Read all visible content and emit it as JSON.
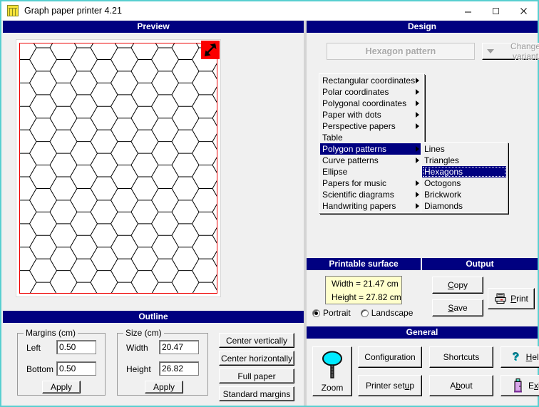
{
  "window": {
    "title": "Graph paper printer 4.21",
    "icon": "graph-paper-icon",
    "minimize": "–",
    "maximize": "□",
    "close": "✕"
  },
  "preview": {
    "caption": "Preview",
    "resize_handle_icon": "resize-diagonal-arrow-icon",
    "paper_border_color": "#ee0000",
    "pattern": "hexagons"
  },
  "design": {
    "caption": "Design",
    "pattern_name": "Hexagon pattern",
    "change_variant": "Change variant",
    "change_variant_icon": "chevron-down-icon",
    "menu": [
      {
        "label": "Rectangular coordinates",
        "submenu": true,
        "selected": false
      },
      {
        "label": "Polar coordinates",
        "submenu": true,
        "selected": false
      },
      {
        "label": "Polygonal coordinates",
        "submenu": true,
        "selected": false
      },
      {
        "label": "Paper with dots",
        "submenu": true,
        "selected": false
      },
      {
        "label": "Perspective papers",
        "submenu": true,
        "selected": false
      },
      {
        "label": "Table",
        "submenu": false,
        "selected": false
      },
      {
        "label": "Polygon patterns",
        "submenu": true,
        "selected": true
      },
      {
        "label": "Curve patterns",
        "submenu": true,
        "selected": false
      },
      {
        "label": "Ellipse",
        "submenu": false,
        "selected": false
      },
      {
        "label": "Papers for music",
        "submenu": true,
        "selected": false
      },
      {
        "label": "Scientific diagrams",
        "submenu": true,
        "selected": false
      },
      {
        "label": "Handwriting papers",
        "submenu": true,
        "selected": false
      }
    ],
    "submenu": [
      {
        "label": "Lines",
        "selected": false
      },
      {
        "label": "Triangles",
        "selected": false
      },
      {
        "label": "Hexagons",
        "selected": true
      },
      {
        "label": "Octogons",
        "selected": false
      },
      {
        "label": "Brickwork",
        "selected": false
      },
      {
        "label": "Diamonds",
        "selected": false
      }
    ]
  },
  "outline": {
    "caption": "Outline",
    "margins": {
      "legend": "Margins (cm)",
      "left_label": "Left",
      "left_value": "0.50",
      "bottom_label": "Bottom",
      "bottom_value": "0.50",
      "apply": "Apply"
    },
    "size": {
      "legend": "Size (cm)",
      "width_label": "Width",
      "width_value": "20.47",
      "height_label": "Height",
      "height_value": "26.82",
      "apply": "Apply"
    },
    "actions": [
      "Center vertically",
      "Center horizontally",
      "Full paper",
      "Standard margins"
    ]
  },
  "printable_surface": {
    "caption": "Printable surface",
    "width_text": "Width = 21.47 cm",
    "height_text": "Height = 27.82 cm",
    "orientation_portrait": "Portrait",
    "orientation_landscape": "Landscape",
    "selected_orientation": "Portrait"
  },
  "output": {
    "caption": "Output",
    "copy": "Copy",
    "save": "Save",
    "print": "Print",
    "print_icon": "printer-icon"
  },
  "general": {
    "caption": "General",
    "zoom": "Zoom",
    "zoom_icon": "magnifier-icon",
    "configuration": "Configuration",
    "printer_setup": "Printer setup",
    "shortcuts": "Shortcuts",
    "about": "About",
    "help": "Help",
    "help_icon": "question-mark-icon",
    "exit": "Exit",
    "exit_icon": "exit-door-icon"
  },
  "colors": {
    "caption_bg": "#000080",
    "window_border": "#58cfd0",
    "panel_bg": "#f0f0f0",
    "paper_outline": "#ee0000",
    "dim_box_bg": "#ffffcc",
    "handle": "#fb0000"
  }
}
